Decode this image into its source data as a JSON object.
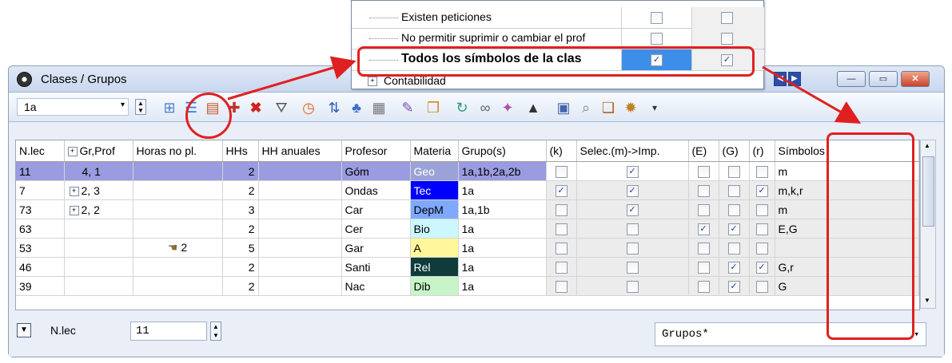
{
  "window": {
    "title": "Clases / Grupos",
    "nav_prev": "◀",
    "nav_next": "▶",
    "minimize": "—",
    "maximize": "▭",
    "close": "✕"
  },
  "toolbar": {
    "class_value": "1a",
    "dropdown_icon": "▾",
    "icons": [
      "grid-icon",
      "list-icon",
      "new-entry-icon",
      "new-class-icon",
      "delete-icon",
      "filter-icon",
      "clock-icon",
      "sort-icon",
      "split-icon",
      "keyboard-icon",
      "palette-icon",
      "document-icon",
      "refresh-icon",
      "link-icon",
      "tools-icon",
      "graduation-icon",
      "calendar-icon",
      "search-icon",
      "windows-icon",
      "gear-icon"
    ]
  },
  "popup": {
    "rows": [
      {
        "label": "Existen peticiones",
        "c1": "",
        "c2": ""
      },
      {
        "label": "No permitir suprimir o cambiar el prof",
        "c1": "",
        "c2": ""
      },
      {
        "label": "Todos los símbolos de la clas",
        "c1": "✓",
        "c2": "✓"
      },
      {
        "label": "Contabilidad",
        "c1": "",
        "c2": ""
      }
    ]
  },
  "grid": {
    "headers": [
      "N.lec",
      "Gr,Prof",
      "Horas no pl.",
      "HHs",
      "HH anuales",
      "Profesor",
      "Materia",
      "Grupo(s)",
      "(k)",
      "Selec.(m)->Imp.",
      "(E)",
      "(G)",
      "(r)",
      "Símbolos"
    ],
    "rows": [
      {
        "nlec": "11",
        "grprof": "4, 1",
        "exp": false,
        "horas": "",
        "hhs": "2",
        "hha": "",
        "prof": "Góm",
        "mat": "Geo",
        "matbg": "#9aa2d7",
        "matfg": "#ffffff",
        "grupo": "1a,1b,2a,2b",
        "k": "",
        "m": "✓",
        "e": "",
        "g": "",
        "r": "",
        "sym": "m",
        "selected": true
      },
      {
        "nlec": "7",
        "grprof": "2, 3",
        "exp": true,
        "horas": "",
        "hhs": "2",
        "hha": "",
        "prof": "Ondas",
        "mat": "Tec",
        "matbg": "#0000ff",
        "matfg": "#ffffff",
        "grupo": "1a",
        "k": "✓",
        "m": "✓",
        "e": "",
        "g": "",
        "r": "✓",
        "sym": "m,k,r",
        "selected": false
      },
      {
        "nlec": "73",
        "grprof": "2, 2",
        "exp": true,
        "horas": "",
        "hhs": "3",
        "hha": "",
        "prof": "Car",
        "mat": "DepM",
        "matbg": "#7fa9ff",
        "matfg": "#000000",
        "grupo": "1a,1b",
        "k": "",
        "m": "✓",
        "e": "",
        "g": "",
        "r": "",
        "sym": "m",
        "selected": false
      },
      {
        "nlec": "63",
        "grprof": "",
        "exp": false,
        "horas": "",
        "hhs": "2",
        "hha": "",
        "prof": "Cer",
        "mat": "Bio",
        "matbg": "#cdf7ff",
        "matfg": "#000000",
        "grupo": "1a",
        "k": "",
        "m": "",
        "e": "✓",
        "g": "✓",
        "r": "",
        "sym": "E,G",
        "selected": false
      },
      {
        "nlec": "53",
        "grprof": "",
        "exp": false,
        "horas": "2",
        "hhs": "5",
        "hha": "",
        "prof": "Gar",
        "mat": "A",
        "matbg": "#fff799",
        "matfg": "#000000",
        "grupo": "1a",
        "k": "",
        "m": "",
        "e": "",
        "g": "",
        "r": "",
        "sym": "",
        "selected": false
      },
      {
        "nlec": "46",
        "grprof": "",
        "exp": false,
        "horas": "",
        "hhs": "2",
        "hha": "",
        "prof": "Santi",
        "mat": "Rel",
        "matbg": "#0f3c3a",
        "matfg": "#ffffff",
        "grupo": "1a",
        "k": "",
        "m": "",
        "e": "",
        "g": "✓",
        "r": "✓",
        "sym": "G,r",
        "selected": false
      },
      {
        "nlec": "39",
        "grprof": "",
        "exp": false,
        "horas": "",
        "hhs": "2",
        "hha": "",
        "prof": "Nac",
        "mat": "Dib",
        "matbg": "#c7f5c9",
        "matfg": "#000000",
        "grupo": "1a",
        "k": "",
        "m": "",
        "e": "",
        "g": "✓",
        "r": "",
        "sym": "G",
        "selected": false
      }
    ]
  },
  "bottom": {
    "expand_icon": "▼",
    "nlec_label": "N.lec",
    "nlec_value": "11",
    "grupos_value": "Grupos*",
    "grupos_arrow": "▾"
  }
}
